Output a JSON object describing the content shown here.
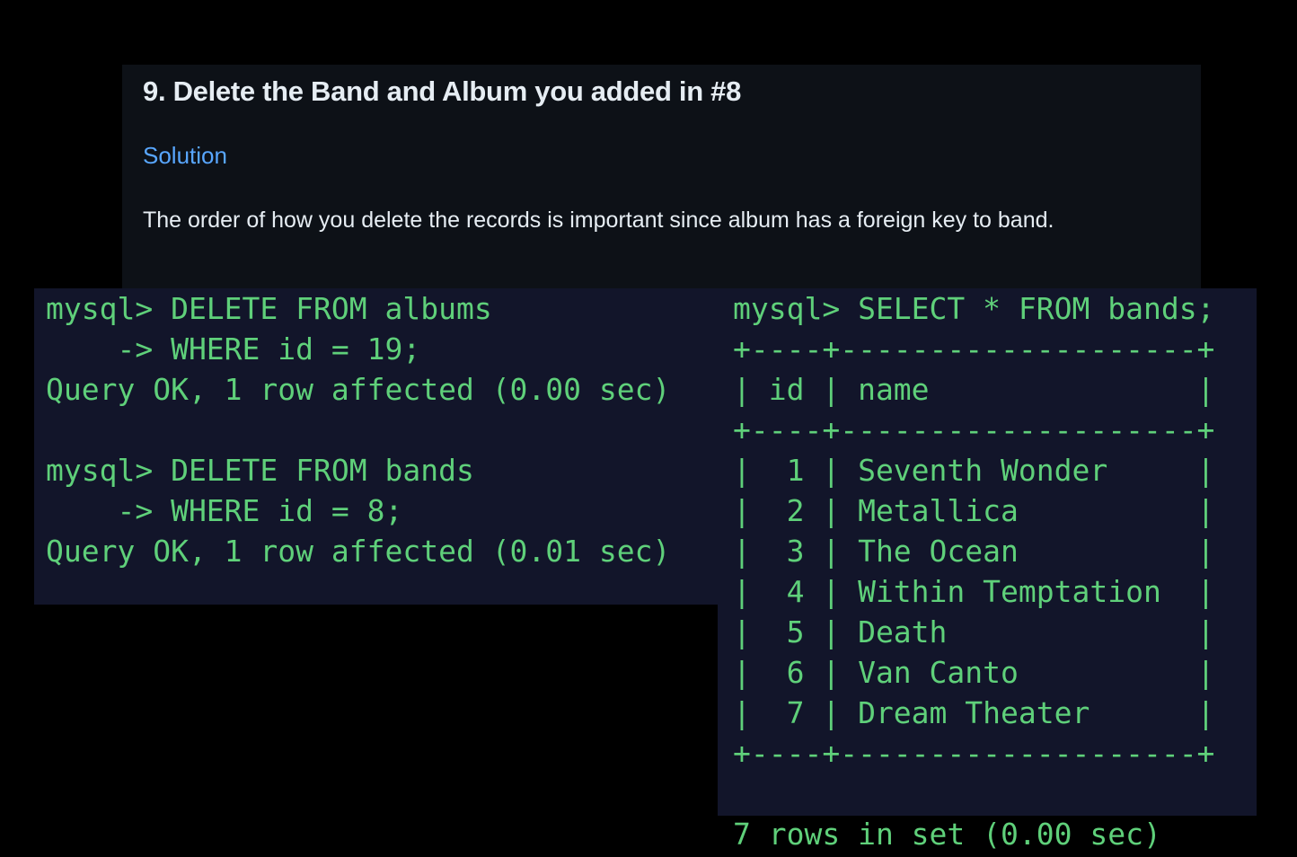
{
  "doc": {
    "title": "9. Delete the Band and Album you added in #8",
    "link": "Solution",
    "paragraph": "The order of how you delete the records is important since album has a foreign key to band."
  },
  "terminal_left": {
    "lines": [
      "mysql> DELETE FROM albums",
      "    -> WHERE id = 19;",
      "Query OK, 1 row affected (0.00 sec)",
      "",
      "mysql> DELETE FROM bands",
      "    -> WHERE id = 8;",
      "Query OK, 1 row affected (0.01 sec)"
    ]
  },
  "terminal_right": {
    "lines": [
      "mysql> SELECT * FROM bands;",
      "+----+--------------------+",
      "| id | name               |",
      "+----+--------------------+",
      "|  1 | Seventh Wonder     |",
      "|  2 | Metallica          |",
      "|  3 | The Ocean          |",
      "|  4 | Within Temptation  |",
      "|  5 | Death              |",
      "|  6 | Van Canto          |",
      "|  7 | Dream Theater      |",
      "+----+--------------------+",
      "",
      "7 rows in set (0.00 sec)"
    ]
  },
  "colors": {
    "doc_background": "#0d1117",
    "doc_text": "#e6edf3",
    "link": "#58a6ff",
    "terminal_background": "#12152a",
    "terminal_text": "#5fd07a"
  }
}
